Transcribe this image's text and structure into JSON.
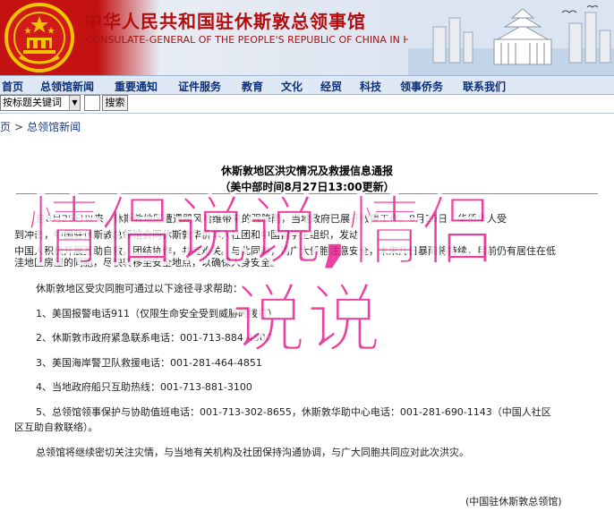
{
  "banner": {
    "title_cn": "中华人民共和国驻休斯敦总领事馆",
    "title_en": "CONSULATE-GENERAL OF THE PEOPLE'S REPUBLIC OF CHINA IN HOUSTON"
  },
  "nav": {
    "items": [
      "首页",
      "总领馆新闻",
      "重要通知",
      "证件服务",
      "教育",
      "文化",
      "经贸",
      "科技",
      "领事侨务",
      "联系我们"
    ]
  },
  "search": {
    "select_value": "按标题关键词",
    "button_label": "搜索"
  },
  "breadcrumb": {
    "home": "页",
    "section": "总领馆新闻"
  },
  "article": {
    "title": "休斯敦地区洪灾情况及救援信息通报",
    "date": "（美中部时间8月27日13:00更新）",
    "para1_line1": "自8月25日以来，休斯敦地区遭遇飓风哈维带来的强降雨，当地政府已展开救援工作。8月26日，华侨华人受",
    "para1_line2": "到冲击，中国驻休斯敦总领馆会同休斯敦华侨华人社团和中国留学生组织，发动",
    "para1_line3": "中国人积极开展互助自救，团结协作，共度难关。与此同时，请广大侨胞注意安全，未来几日暴雨将持续，目前仍有居住在低",
    "para1_line4": "洼地区房屋的同胞，尽快转移至安全地点，以确保人身安全。",
    "para2": "休斯敦地区受灾同胞可通过以下途径寻求帮助：",
    "item1": "1、美国报警电话911（仅限生命安全受到威胁时拨打）",
    "item2": "2、休斯敦市政府紧急联系电话：001-713-884-4500",
    "item3": "3、美国海岸警卫队救援电话：001-281-464-4851",
    "item4": "4、当地政府船只互助热线：001-713-881-3100",
    "item5_line1": "5、总领馆领事保护与协助值班电话：001-713-302-8655，休斯敦华助中心电话：001-281-690-1143（中国人社区",
    "item5_line2": "区互助自救联络）。",
    "closing": "总领馆将继续密切关注灾情，与当地有关机构及社团保持沟通协调，与广大同胞共同应对此次洪灾。",
    "signature": "(中国驻休斯敦总领馆)"
  },
  "watermark": {
    "line1": "情侣说说,情侣",
    "line2": "说说"
  },
  "colors": {
    "banner_red": "#c41212",
    "nav_bg": "#dfe9f6",
    "nav_text": "#0d2f78",
    "watermark": "#e6178b"
  }
}
